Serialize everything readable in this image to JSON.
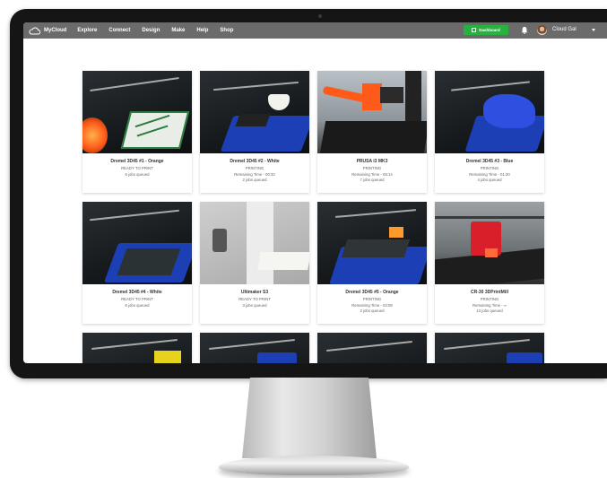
{
  "nav": {
    "brand": "MyCloud",
    "items": [
      "Explore",
      "Connect",
      "Design",
      "Make",
      "Help",
      "Shop"
    ],
    "dashboard_label": "Dashboard",
    "user_name": "Cloud Gal"
  },
  "printers": [
    {
      "name": "Dremel 3D45 #1 - Orange",
      "status": "READY TO PRINT",
      "remaining": "",
      "jobs": "6 jobs queued"
    },
    {
      "name": "Dremel 3D45 #2 - White",
      "status": "PRINTING",
      "remaining": "Remaining Time - 00:32",
      "jobs": "2 jobs queued"
    },
    {
      "name": "PRUSA i3 MK3",
      "status": "PRINTING",
      "remaining": "Remaining Time - 06:14",
      "jobs": "7 jobs queued"
    },
    {
      "name": "Dremel 3D45 #3 - Blue",
      "status": "PRINTING",
      "remaining": "Remaining Time - 01:20",
      "jobs": "4 jobs queued"
    },
    {
      "name": "Dremel 3D45 #4 - White",
      "status": "READY TO PRINT",
      "remaining": "",
      "jobs": "6 jobs queued"
    },
    {
      "name": "Ultimaker S3",
      "status": "READY TO PRINT",
      "remaining": "",
      "jobs": "3 jobs queued"
    },
    {
      "name": "Dremel 3D45 #5 - Orange",
      "status": "PRINTING",
      "remaining": "Remaining Time - 02:08",
      "jobs": "2 jobs queued"
    },
    {
      "name": "CR-30 3DPrintMill",
      "status": "PRINTING",
      "remaining": "Remaining Time - ∞",
      "jobs": "13 jobs queued"
    }
  ],
  "colors": {
    "nav_bg": "#6b6b6b",
    "dashboard": "#27b23f",
    "bed_blue": "#1d3fb5",
    "orange": "#ff5a1a"
  }
}
